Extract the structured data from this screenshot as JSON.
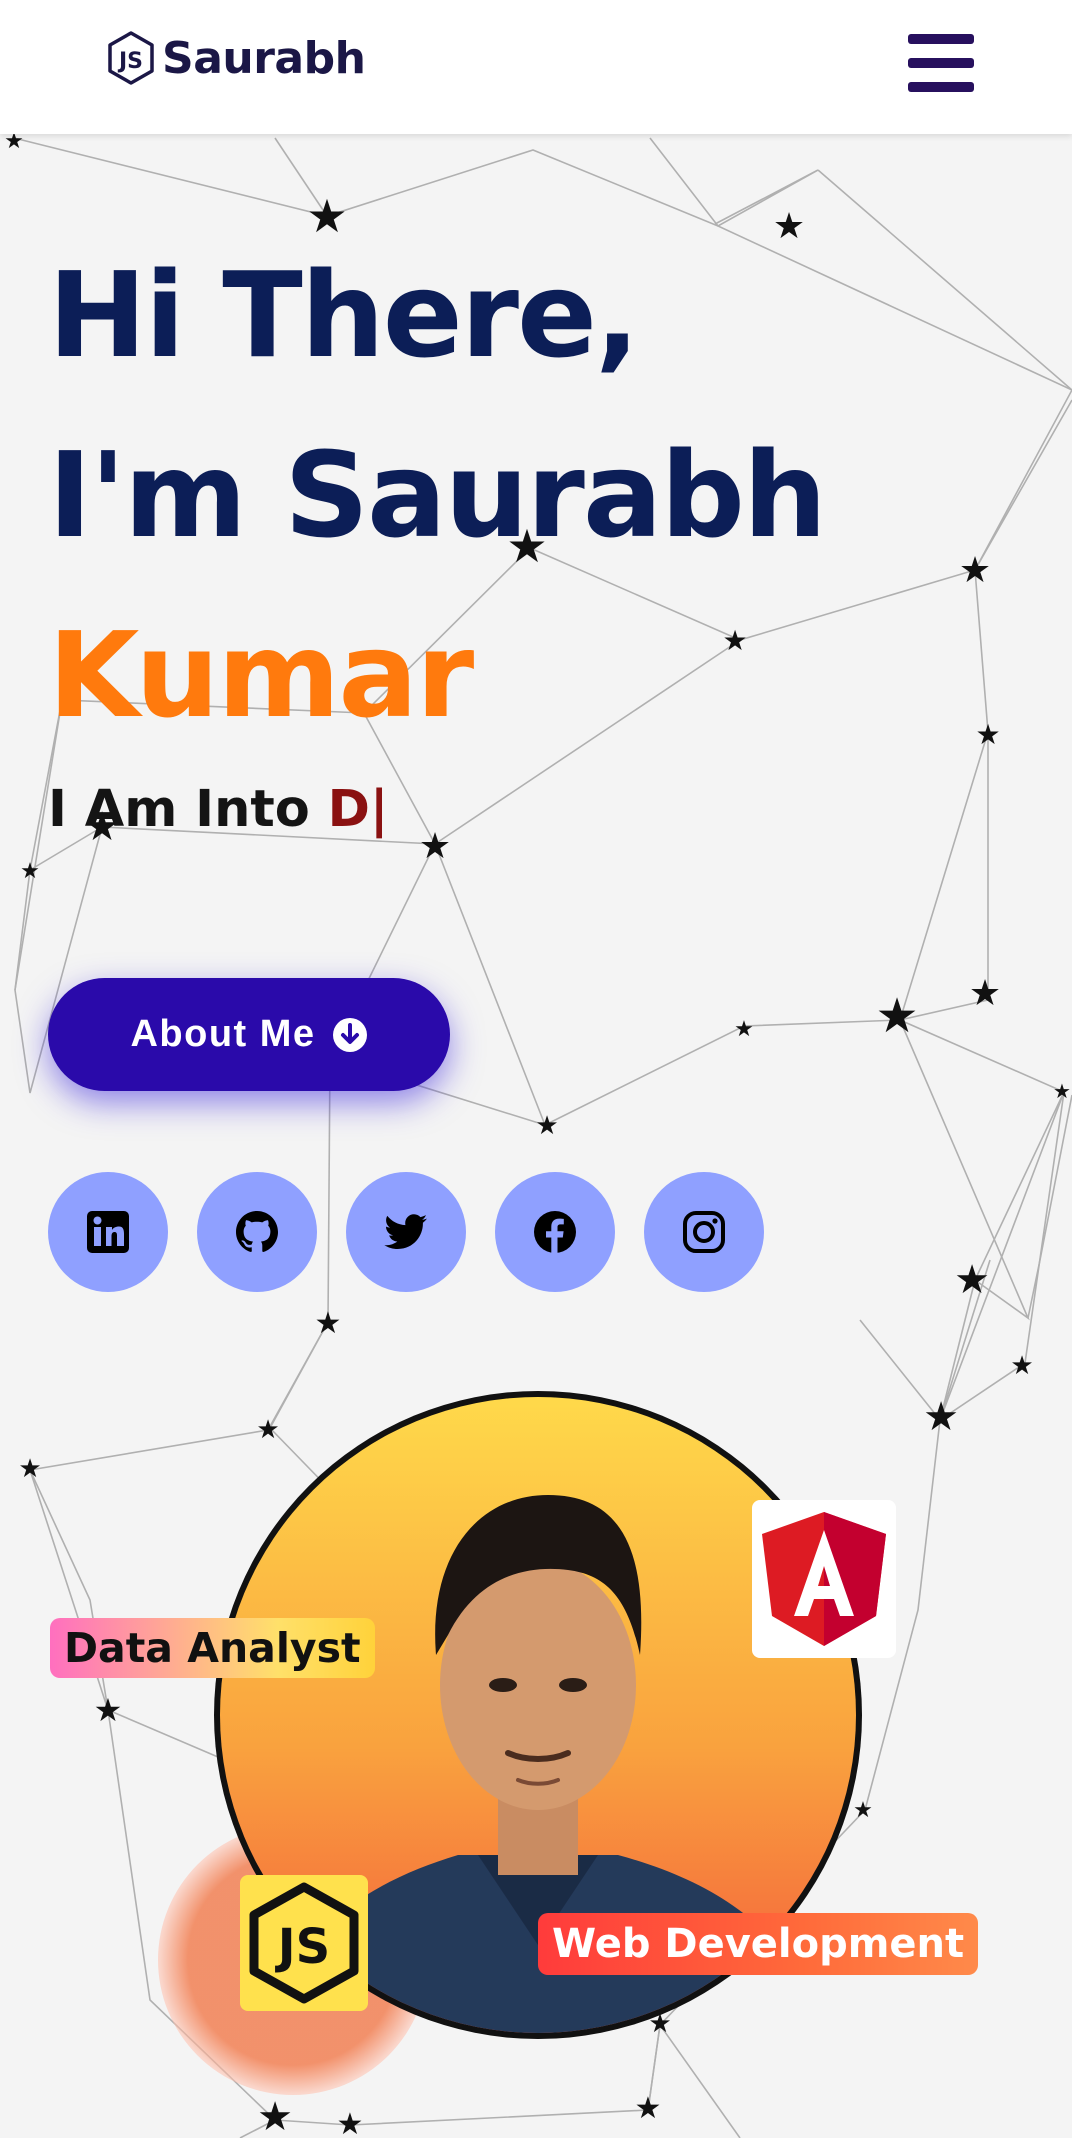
{
  "header": {
    "brand_name": "Saurabh",
    "logo_icon": "js-hexagon-icon",
    "menu_icon": "hamburger-menu-icon"
  },
  "hero": {
    "line1": "Hi There,",
    "line2": "I'm Saurabh",
    "line3": "Kumar",
    "tagline_prefix": "I Am Into",
    "typed_text": "D",
    "cursor": "|",
    "about_button_label": "About Me",
    "about_button_icon": "arrow-down-circle-icon"
  },
  "socials": [
    {
      "name": "linkedin",
      "icon": "linkedin-icon"
    },
    {
      "name": "github",
      "icon": "github-icon"
    },
    {
      "name": "twitter",
      "icon": "twitter-icon"
    },
    {
      "name": "facebook",
      "icon": "facebook-icon"
    },
    {
      "name": "instagram",
      "icon": "instagram-icon"
    }
  ],
  "profile": {
    "badge_left": "Data Analyst",
    "badge_right": "Web Development",
    "angular_icon": "angular-icon",
    "js_icon": "nodejs-icon"
  },
  "colors": {
    "heading": "#0c1e57",
    "accent": "#ff7a0d",
    "button": "#2a0aaa",
    "social_bg": "#8fa0ff",
    "typed": "#8a1111"
  }
}
